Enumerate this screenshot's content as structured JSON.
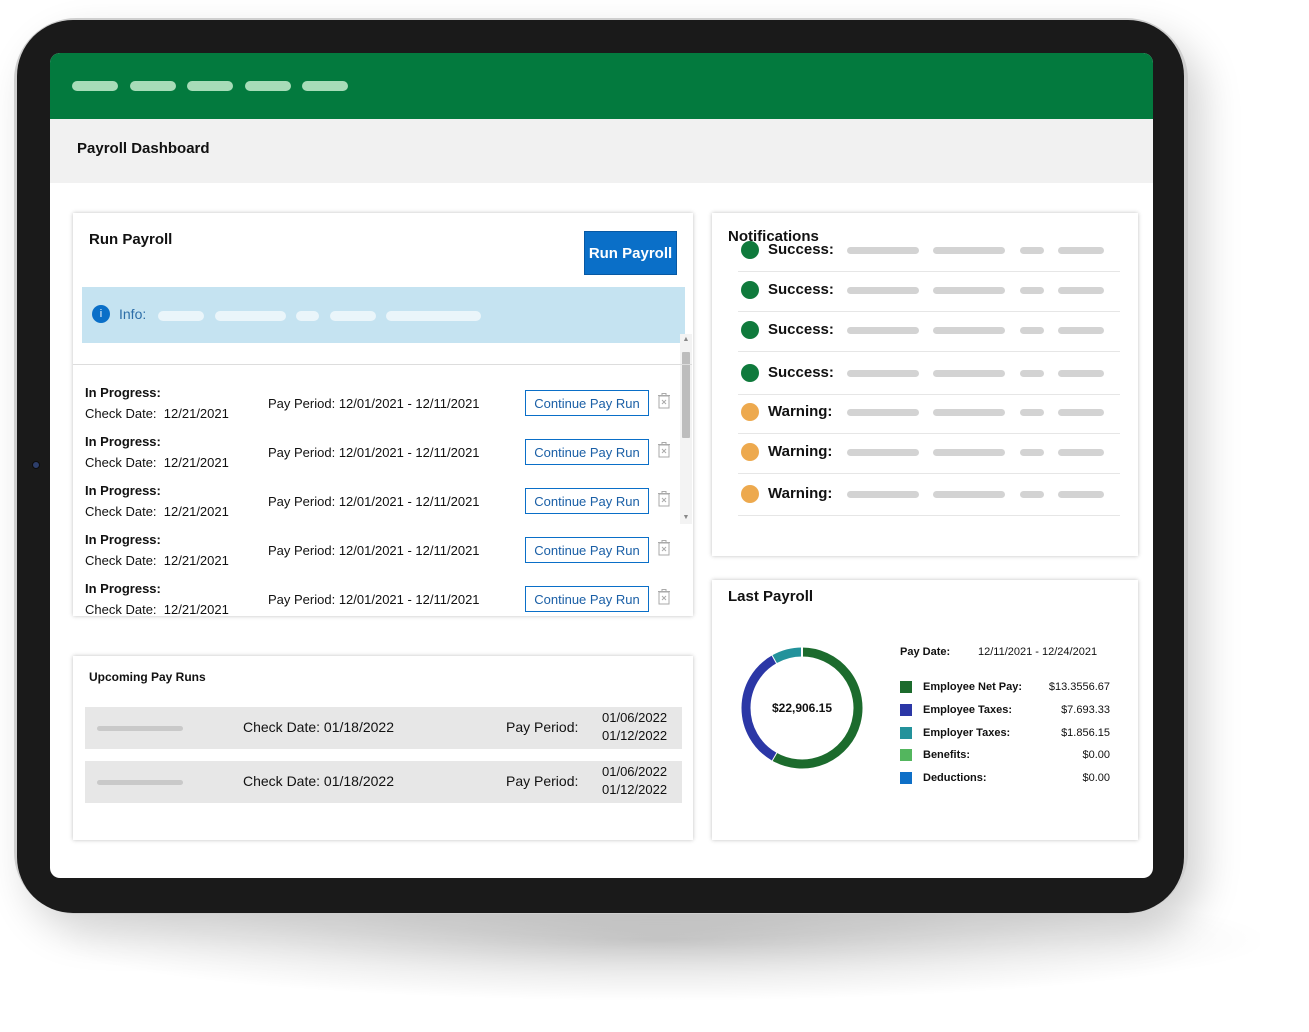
{
  "header": {
    "page_title": "Payroll Dashboard",
    "nav_items": [
      {
        "id": "nav-1"
      },
      {
        "id": "nav-2"
      },
      {
        "id": "nav-3"
      },
      {
        "id": "nav-4"
      },
      {
        "id": "nav-5"
      }
    ]
  },
  "run_payroll": {
    "title": "Run Payroll",
    "button_label": "Run Payroll",
    "info_label": "Info:",
    "rows": [
      {
        "status": "In Progress:",
        "check_label": "Check Date:",
        "check_date": "12/21/2021",
        "pay_period": "Pay Period: 12/01/2021 - 12/11/2021",
        "action": "Continue Pay Run"
      },
      {
        "status": "In Progress:",
        "check_label": "Check Date:",
        "check_date": "12/21/2021",
        "pay_period": "Pay Period: 12/01/2021 - 12/11/2021",
        "action": "Continue Pay Run"
      },
      {
        "status": "In Progress:",
        "check_label": "Check Date:",
        "check_date": "12/21/2021",
        "pay_period": "Pay Period: 12/01/2021 - 12/11/2021",
        "action": "Continue Pay Run"
      },
      {
        "status": "In Progress:",
        "check_label": "Check Date:",
        "check_date": "12/21/2021",
        "pay_period": "Pay Period: 12/01/2021 - 12/11/2021",
        "action": "Continue Pay Run"
      },
      {
        "status": "In Progress:",
        "check_label": "Check Date:",
        "check_date": "12/21/2021",
        "pay_period": "Pay Period: 12/01/2021 - 12/11/2021",
        "action": "Continue Pay Run"
      }
    ]
  },
  "upcoming": {
    "title": "Upcoming Pay Runs",
    "rows": [
      {
        "check": "Check Date: 01/18/2022",
        "pp_label": "Pay Period:",
        "start": "01/06/2022",
        "end": "01/12/2022"
      },
      {
        "check": "Check Date: 01/18/2022",
        "pp_label": "Pay Period:",
        "start": "01/06/2022",
        "end": "01/12/2022"
      }
    ]
  },
  "notifications": {
    "title": "Notifications",
    "items": [
      {
        "label": "Success:",
        "status": "success",
        "color": "#0f7a3c"
      },
      {
        "label": "Success:",
        "status": "success",
        "color": "#0f7a3c"
      },
      {
        "label": "Success:",
        "status": "success",
        "color": "#0f7a3c"
      },
      {
        "label": "Success:",
        "status": "success",
        "color": "#0f7a3c"
      },
      {
        "label": "Warning:",
        "status": "warning",
        "color": "#eda94e"
      },
      {
        "label": "Warning:",
        "status": "warning",
        "color": "#eda94e"
      },
      {
        "label": "Warning:",
        "status": "warning",
        "color": "#eda94e"
      }
    ]
  },
  "last_payroll": {
    "title": "Last Payroll",
    "pay_date_label": "Pay Date:",
    "pay_date_range": "12/11/2021 - 12/24/2021",
    "total": "$22,906.15",
    "legend": [
      {
        "name": "Employee Net Pay:",
        "value": "$13.3556.67",
        "color": "#1c6b2d"
      },
      {
        "name": "Employee Taxes:",
        "value": "$7.693.33",
        "color": "#2b37a6"
      },
      {
        "name": "Employer Taxes:",
        "value": "$1.856.15",
        "color": "#23929b"
      },
      {
        "name": "Benefits:",
        "value": "$0.00",
        "color": "#53b65e"
      },
      {
        "name": "Deductions:",
        "value": "$0.00",
        "color": "#0e6fc7"
      }
    ]
  },
  "chart_data": {
    "type": "pie",
    "categories": [
      "Employee Net Pay",
      "Employee Taxes",
      "Employer Taxes",
      "Benefits",
      "Deductions"
    ],
    "values": [
      13355.67,
      7693.33,
      1856.15,
      0,
      0
    ],
    "title": "Last Payroll",
    "center_label": "$22,906.15"
  },
  "colors": {
    "brand_green": "#037a3e",
    "primary_blue": "#0a6fc8",
    "info_bg": "#c5e3f1"
  }
}
